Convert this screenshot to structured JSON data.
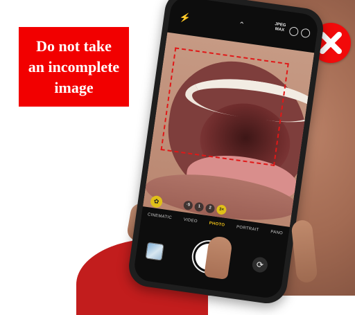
{
  "warning": {
    "text": "Do not take\nan incomplete\nimage",
    "bg_color": "#f20000",
    "text_color": "#ffffff"
  },
  "badge": {
    "icon": "close-icon",
    "color": "#f20a0a"
  },
  "camera": {
    "top_bar": {
      "flash_icon": "⚡",
      "chevron_icon": "⌃",
      "format_label_line1": "JPEG",
      "format_label_line2": "MAX"
    },
    "zoom_levels": [
      "·5",
      "1",
      "2"
    ],
    "macro_label": "3×",
    "modes": [
      {
        "label": "CINEMATIC",
        "active": false
      },
      {
        "label": "VIDEO",
        "active": false
      },
      {
        "label": "PHOTO",
        "active": true
      },
      {
        "label": "PORTRAIT",
        "active": false
      },
      {
        "label": "PANO",
        "active": false
      }
    ],
    "flip_icon": "⟳",
    "focus_box_color": "#e01818"
  }
}
